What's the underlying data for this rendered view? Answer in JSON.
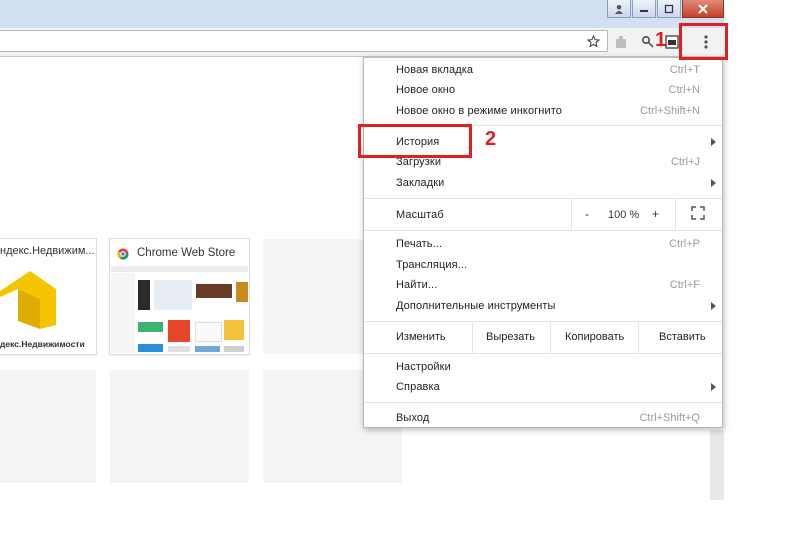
{
  "window": {
    "buttons": [
      "user-icon",
      "minimize-icon",
      "maximize-icon",
      "close-icon"
    ]
  },
  "toolbar": {
    "icons": [
      "star-icon",
      "extension-icon",
      "search-extension-icon",
      "extension-icon-2",
      "menu-dots-icon"
    ]
  },
  "tiles": [
    {
      "title": "ндекс.Недвижим...",
      "caption": "декс.Недвижимости"
    },
    {
      "title": "Chrome Web Store"
    }
  ],
  "menu": {
    "new_tab": {
      "label": "Новая вкладка",
      "shortcut": "Ctrl+T"
    },
    "new_window": {
      "label": "Новое окно",
      "shortcut": "Ctrl+N"
    },
    "incognito": {
      "label": "Новое окно в режиме инкогнито",
      "shortcut": "Ctrl+Shift+N"
    },
    "history": {
      "label": "История"
    },
    "downloads": {
      "label": "Загрузки",
      "shortcut": "Ctrl+J"
    },
    "bookmarks": {
      "label": "Закладки"
    },
    "zoom": {
      "label": "Масштаб",
      "minus": "-",
      "value": "100 %",
      "plus": "+"
    },
    "print": {
      "label": "Печать...",
      "shortcut": "Ctrl+P"
    },
    "cast": {
      "label": "Трансляция..."
    },
    "find": {
      "label": "Найти...",
      "shortcut": "Ctrl+F"
    },
    "more_tools": {
      "label": "Дополнительные инструменты"
    },
    "edit": {
      "label": "Изменить",
      "cut": "Вырезать",
      "copy": "Копировать",
      "paste": "Вставить"
    },
    "settings": {
      "label": "Настройки"
    },
    "help": {
      "label": "Справка"
    },
    "exit": {
      "label": "Выход",
      "shortcut": "Ctrl+Shift+Q"
    }
  },
  "annotations": {
    "step1": "1",
    "step2": "2",
    "color": "#e02020"
  }
}
